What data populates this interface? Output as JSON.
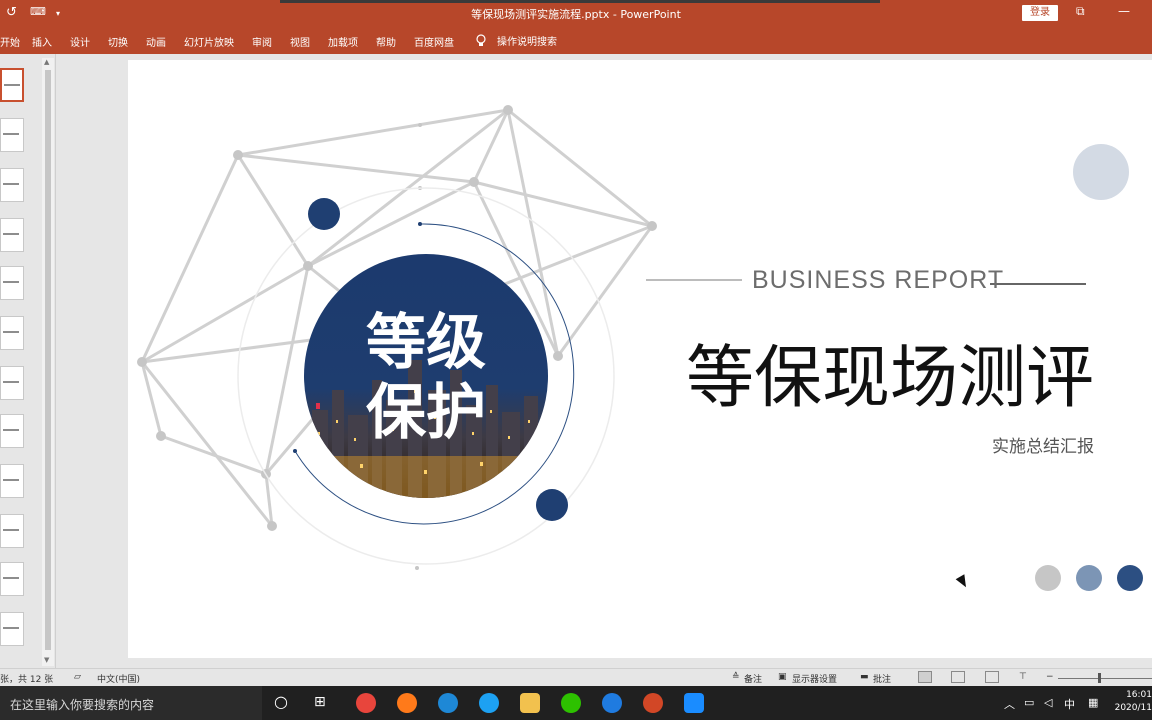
{
  "window": {
    "title": "等保现场测评实施流程.pptx  -  PowerPoint",
    "login_label": "登录",
    "quick_access": [
      "↺",
      "⌨",
      "▾"
    ],
    "controls": [
      "⧉",
      "—",
      "✕"
    ]
  },
  "ribbon": {
    "tabs": [
      "开始",
      "插入",
      "设计",
      "切换",
      "动画",
      "幻灯片放映",
      "审阅",
      "视图",
      "加载项",
      "帮助",
      "百度网盘"
    ],
    "tell_me": "操作说明搜索",
    "tell_me_icon": "lightbulb-icon"
  },
  "thumbnails": {
    "count": 12,
    "active_index": 0
  },
  "slide": {
    "badge_line1": "等级",
    "badge_line2": "保护",
    "business_report": "BUSINESS  REPORT",
    "title": "等保现场测评",
    "subtitle": "实施总结汇报",
    "colors": {
      "navy": "#1f3f72",
      "light_blue_circle": "#d3dae4",
      "grey_dot": "#c6c6c6",
      "mid_blue_dot": "#7c95b5",
      "dark_blue_dot": "#2c4f82",
      "network_line": "#d0d0d0"
    }
  },
  "statusbar": {
    "slide_info": "张，共 12 张",
    "language": "中文(中国)",
    "notes": "备注",
    "display_settings": "显示器设置",
    "comments": "批注"
  },
  "taskbar": {
    "search_placeholder": "在这里输入你要搜索的内容",
    "tray_ime": "中",
    "clock_time": "16:01",
    "clock_date": "2020/11"
  }
}
